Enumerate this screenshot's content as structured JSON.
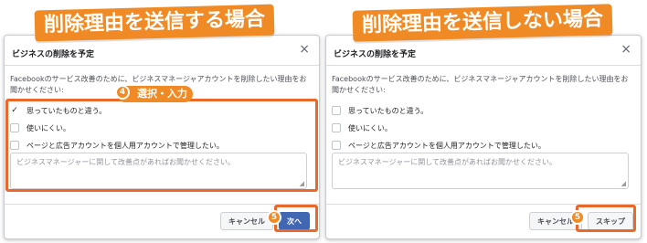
{
  "left": {
    "banner": "削除理由を送信する場合",
    "dialog": {
      "title": "ビジネスの削除を予定",
      "close": "×",
      "description": "Facebookのサービス改善のために、ビジネスマネージャアカウントを削除したい理由をお聞かせください:",
      "options": [
        {
          "label": "思っていたものと違う。",
          "checked": true
        },
        {
          "label": "使いにくい。",
          "checked": false
        },
        {
          "label": "ページと広告アカウントを個人用アカウントで管理したい。",
          "checked": false
        }
      ],
      "textarea_placeholder": "ビジネスマネージャーに関して改善点があればお聞かせください。",
      "cancel_label": "キャンセル",
      "primary_label": "次へ"
    },
    "step_tag": {
      "number": "4",
      "text": "選択・入力"
    },
    "step_badge": "5"
  },
  "right": {
    "banner": "削除理由を送信しない場合",
    "dialog": {
      "title": "ビジネスの削除を予定",
      "close": "×",
      "description": "Facebookのサービス改善のために、ビジネスマネージャアカウントを削除したい理由をお聞かせください:",
      "options": [
        {
          "label": "思っていたものと違う。",
          "checked": false
        },
        {
          "label": "使いにくい。",
          "checked": false
        },
        {
          "label": "ページと広告アカウントを個人用アカウントで管理したい。",
          "checked": false
        }
      ],
      "textarea_placeholder": "ビジネスマネージャーに関して改善点があればお聞かせください。",
      "cancel_label": "キャンセル",
      "primary_label": "スキップ"
    },
    "step_badge": "5"
  },
  "colors": {
    "accent": "#f08a24",
    "facebook_blue": "#4267b2"
  },
  "icons": {
    "check": "check-icon",
    "close": "close-icon",
    "resize": "resize-grip-icon"
  }
}
